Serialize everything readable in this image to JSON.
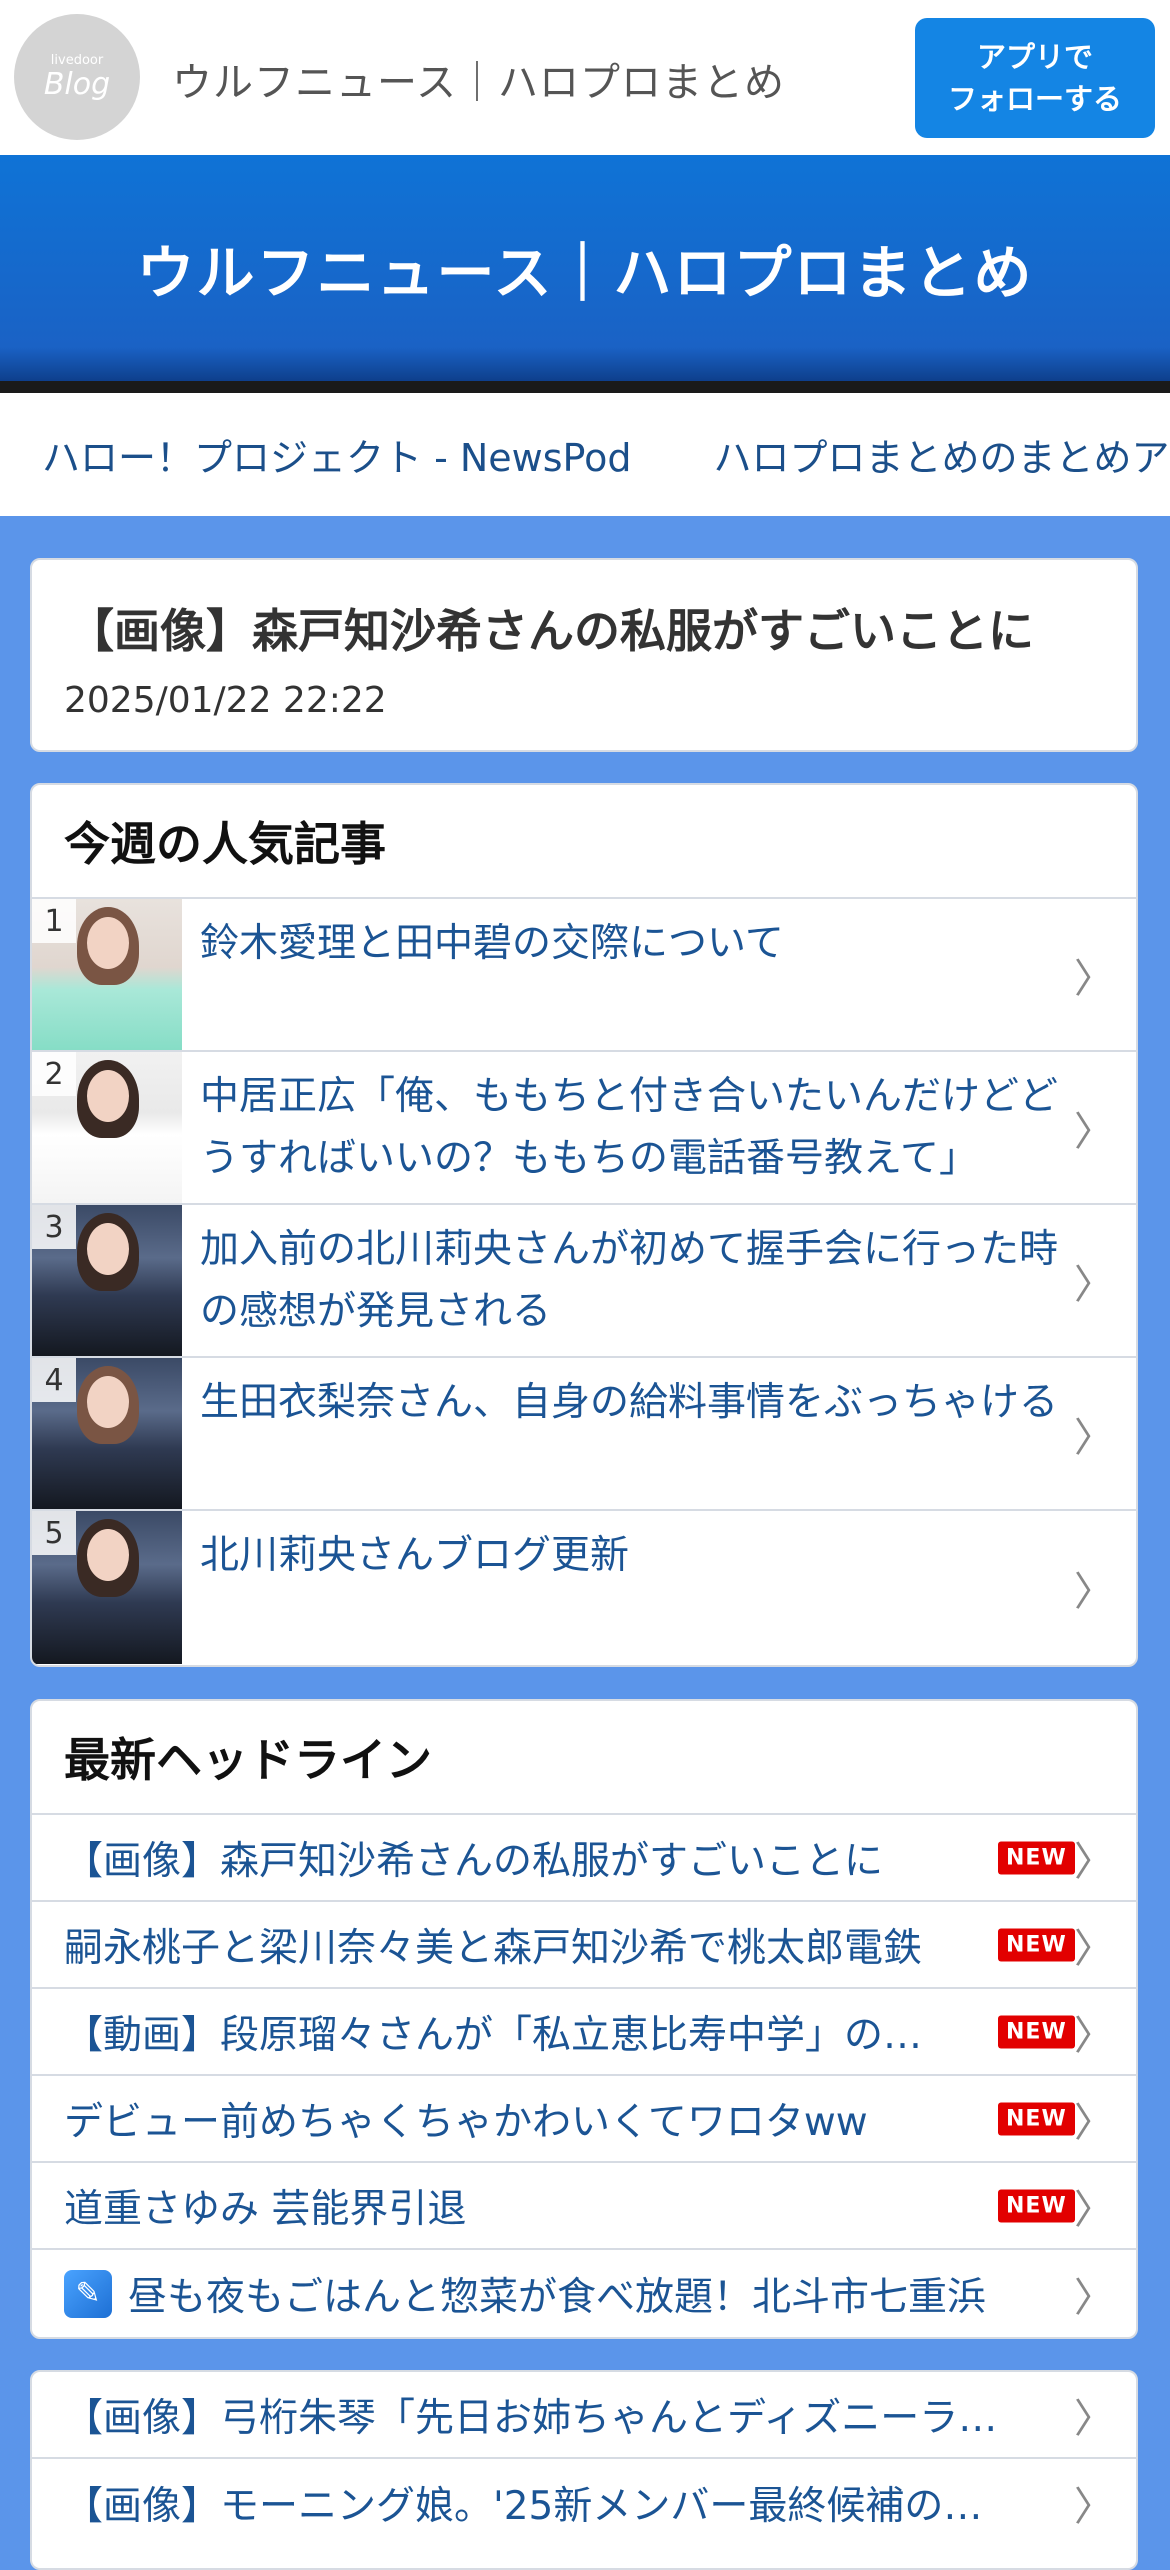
{
  "header": {
    "logo_small": "livedoor",
    "logo_big": "Blog",
    "site_name": "ウルフニュース｜ハロプロまとめ",
    "follow_line1": "アプリで",
    "follow_line2": "フォローする"
  },
  "hero": {
    "title": "ウルフニュース｜ハロプロまとめ"
  },
  "ticker": {
    "items": [
      "ハロー！プロジェクト - NewsPod",
      "ハロプロまとめのまとめアンテナ"
    ]
  },
  "article": {
    "title": "【画像】森戸知沙希さんの私服がすごいことに",
    "date": "2025/01/22 22:22"
  },
  "popular": {
    "title": "今週の人気記事",
    "items": [
      {
        "rank": "1",
        "text": "鈴木愛理と田中碧の交際について"
      },
      {
        "rank": "2",
        "text": "中居正広「俺、ももちと付き合いたいんだけどどうすればいいの？ももちの電話番号教えて」"
      },
      {
        "rank": "3",
        "text": "加入前の北川莉央さんが初めて握手会に行った時の感想が発見される"
      },
      {
        "rank": "4",
        "text": "生田衣梨奈さん、自身の給料事情をぶっちゃける"
      },
      {
        "rank": "5",
        "text": "北川莉央さんブログ更新"
      }
    ]
  },
  "headlines": {
    "title": "最新ヘッドライン",
    "new_label": "NEW",
    "items": [
      {
        "text": "【画像】森戸知沙希さんの私服がすごいことに"
      },
      {
        "text": "嗣永桃子と梁川奈々美と森戸知沙希で桃太郎電鉄"
      },
      {
        "text": "【動画】段原瑠々さんが「私立恵比寿中学」の…"
      },
      {
        "text": "デビュー前めちゃくちゃかわいくてワロタww"
      },
      {
        "text": "道重さゆみ 芸能界引退"
      },
      {
        "text": "昼も夜もごはんと惣菜が食べ放題！北斗市七重浜"
      }
    ]
  },
  "more": {
    "items": [
      {
        "text": "【画像】弓桁朱琴「先日お姉ちゃんとディズニーランド"
      },
      {
        "text": "【画像】モーニング娘。'25新メンバー最終候補の…"
      }
    ]
  }
}
